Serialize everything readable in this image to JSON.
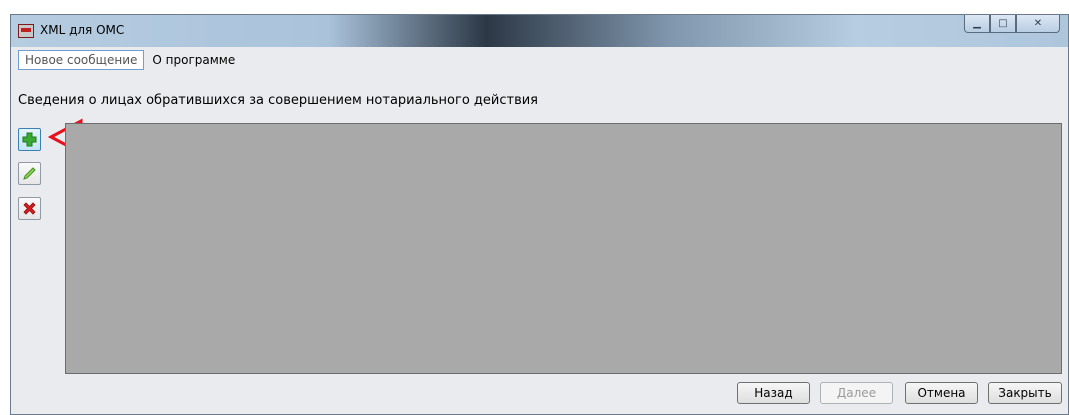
{
  "window": {
    "title": "XML для ОМС"
  },
  "menu": {
    "items": [
      {
        "label": "Новое сообщение"
      },
      {
        "label": "О программе"
      }
    ]
  },
  "section": {
    "title": "Сведения о лицах обратившихся за совершением нотариального действия"
  },
  "toolbar": {
    "add": {
      "icon": "plus-icon",
      "color": "#3aaa35"
    },
    "edit": {
      "icon": "pencil-icon",
      "color": "#4caf2a"
    },
    "delete": {
      "icon": "x-icon",
      "color": "#d81e1e"
    }
  },
  "annotation": {
    "color": "#e8101a"
  },
  "footer": {
    "back": "Назад",
    "next": "Далее",
    "cancel": "Отмена",
    "close": "Закрыть"
  }
}
